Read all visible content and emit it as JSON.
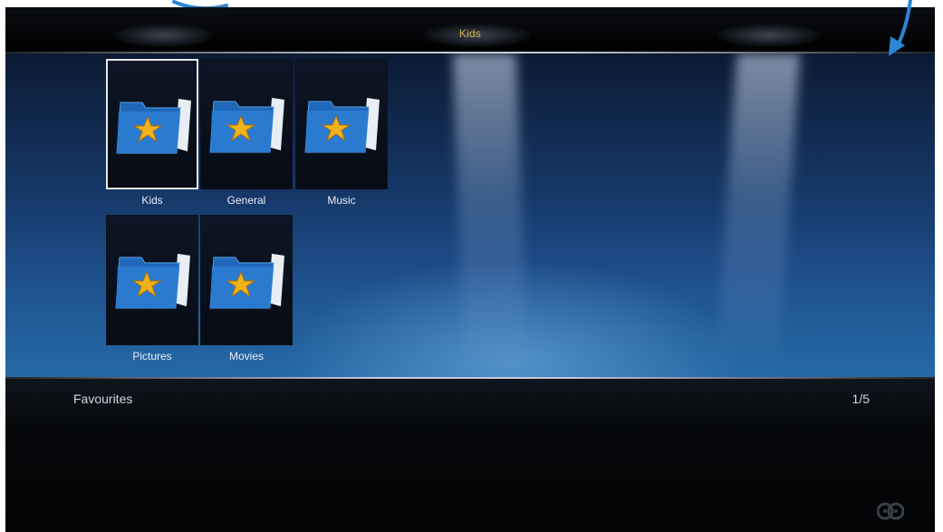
{
  "header": {
    "title": "Kids"
  },
  "grid": {
    "items": [
      {
        "label": "Kids",
        "selected": true
      },
      {
        "label": "General",
        "selected": false
      },
      {
        "label": "Music",
        "selected": false
      },
      {
        "label": "Pictures",
        "selected": false
      },
      {
        "label": "Movies",
        "selected": false
      }
    ]
  },
  "info": {
    "section_title": "Favourites",
    "page_count": "1/5"
  },
  "icons": {
    "tile_icon": "star-folder-icon",
    "bottom_right_icon": "film-reel-icon",
    "annotation": "arrow-icon"
  },
  "colors": {
    "header_title": "#c9b24a",
    "annotation_arrow": "#2b86d6",
    "folder_blue": "#1f67b8",
    "star": "#f2b21c"
  }
}
